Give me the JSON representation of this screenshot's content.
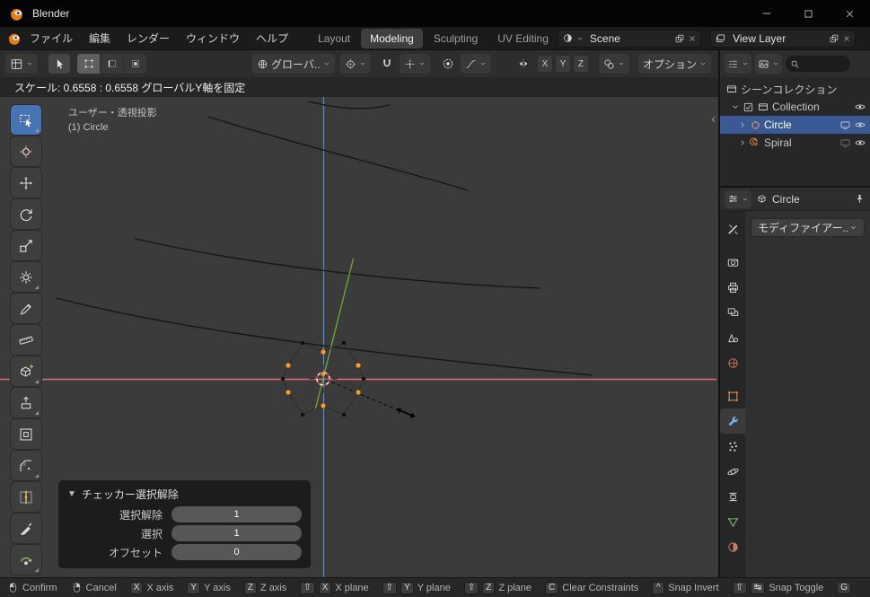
{
  "titlebar": {
    "app_title": "Blender"
  },
  "menubar": {
    "menus": [
      "ファイル",
      "編集",
      "レンダー",
      "ウィンドウ",
      "ヘルプ"
    ],
    "workspaces": [
      "Layout",
      "Modeling",
      "Sculpting",
      "UV Editing"
    ],
    "active_workspace": "Modeling",
    "scene_selector": {
      "value": "Scene"
    },
    "view_layer_selector": {
      "value": "View Layer"
    }
  },
  "tool_header": {
    "transform_orientation": "グローバ..",
    "mirror_axes": [
      "X",
      "Y",
      "Z"
    ],
    "options_label": "オプション"
  },
  "viewport": {
    "operation_status": "スケール: 0.6558 : 0.6558 グローバルY軸を固定",
    "view_label": "ユーザー・透視投影",
    "active_object_label": "(1) Circle",
    "collapse_glyph": "‹"
  },
  "toolbar_tools": [
    "box-select",
    "cursor3d",
    "move",
    "rotate",
    "scale",
    "transform",
    "annotate",
    "measure",
    "add-cube",
    "extrude",
    "inset",
    "bevel",
    "loop-cut",
    "knife",
    "spin"
  ],
  "operator_panel": {
    "title": "チェッカー選択解除",
    "fields": [
      {
        "label": "選択解除",
        "value": "1"
      },
      {
        "label": "選択",
        "value": "1"
      },
      {
        "label": "オフセット",
        "value": "0"
      }
    ]
  },
  "outliner": {
    "rows": [
      {
        "label": "シーンコレクション"
      },
      {
        "label": "Collection"
      },
      {
        "label": "Circle",
        "selected": true
      },
      {
        "label": "Spiral"
      }
    ]
  },
  "properties": {
    "breadcrumb_object": "Circle",
    "add_modifier_label": "モディファイアー..",
    "tabs": [
      "tool",
      "render",
      "output",
      "view-layer",
      "scene",
      "world",
      "object",
      "modifier",
      "particles",
      "physics",
      "constraints",
      "object-data",
      "material"
    ],
    "active_tab": "modifier"
  },
  "statusbar": {
    "items": [
      {
        "mouse": "left",
        "label": "Confirm"
      },
      {
        "mouse": "right",
        "label": "Cancel"
      },
      {
        "keys": [
          "X"
        ],
        "label": "X axis"
      },
      {
        "keys": [
          "Y"
        ],
        "label": "Y axis"
      },
      {
        "keys": [
          "Z"
        ],
        "label": "Z axis"
      },
      {
        "keys": [
          "⇧",
          "X"
        ],
        "label": "X plane"
      },
      {
        "keys": [
          "⇧",
          "Y"
        ],
        "label": "Y plane"
      },
      {
        "keys": [
          "⇧",
          "Z"
        ],
        "label": "Z plane"
      },
      {
        "keys": [
          "C"
        ],
        "label": "Clear Constraints"
      },
      {
        "keys": [
          "^"
        ],
        "label": "Snap Invert"
      },
      {
        "keys": [
          "⇧",
          "↹"
        ],
        "label": "Snap Toggle"
      },
      {
        "keys": [
          "G"
        ],
        "label": ""
      }
    ]
  },
  "colors": {
    "accent_blue": "#4772b3",
    "selected_vertex_orange": "#ff9a1f",
    "axis_x_red": "#e06c79",
    "axis_constraint_green": "#71a832",
    "axis_blue": "#528ad4"
  }
}
